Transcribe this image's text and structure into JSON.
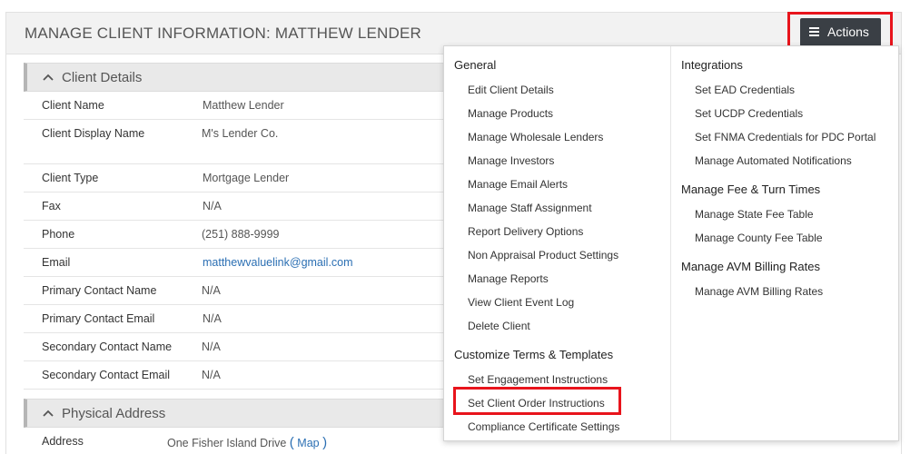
{
  "header": {
    "title": "MANAGE CLIENT INFORMATION: MATTHEW LENDER"
  },
  "actions": {
    "label": "Actions",
    "icon": "menu-icon"
  },
  "client_details": {
    "title": "Client Details",
    "rows": [
      {
        "label": "Client Name",
        "value": "Matthew Lender"
      },
      {
        "label": "Client Display Name",
        "value": "M's Lender Co."
      },
      {
        "label": "Client Type",
        "value": "Mortgage Lender"
      },
      {
        "label": "Fax",
        "value": "N/A"
      },
      {
        "label": "Phone",
        "value": "(251) 888-9999"
      },
      {
        "label": "Email",
        "value": "matthewvaluelink@gmail.com"
      },
      {
        "label": "Primary Contact Name",
        "value": "N/A"
      },
      {
        "label": "Primary Contact Email",
        "value": "N/A"
      },
      {
        "label": "Secondary Contact Name",
        "value": "N/A"
      },
      {
        "label": "Secondary Contact Email",
        "value": "N/A"
      }
    ]
  },
  "physical_address": {
    "title": "Physical Address",
    "address_label": "Address",
    "address_value": "One Fisher Island Drive",
    "open_paren": "(",
    "map_link": "Map",
    "close_paren": ")"
  },
  "menu": {
    "left": [
      {
        "group": "General",
        "items": [
          "Edit Client Details",
          "Manage Products",
          "Manage Wholesale Lenders",
          "Manage Investors",
          "Manage Email Alerts",
          "Manage Staff Assignment",
          "Report Delivery Options",
          "Non Appraisal Product Settings",
          "Manage Reports",
          "View Client Event Log",
          "Delete Client"
        ]
      },
      {
        "group": "Customize Terms & Templates",
        "items": [
          "Set Engagement Instructions",
          "Set Client Order Instructions",
          "Compliance Certificate Settings"
        ]
      }
    ],
    "right": [
      {
        "group": "Integrations",
        "items": [
          "Set EAD Credentials",
          "Set UCDP Credentials",
          "Set FNMA Credentials for PDC Portal",
          "Manage Automated Notifications"
        ]
      },
      {
        "group": "Manage Fee & Turn Times",
        "items": [
          "Manage State Fee Table",
          "Manage County Fee Table"
        ]
      },
      {
        "group": "Manage AVM Billing Rates",
        "items": [
          "Manage AVM Billing Rates"
        ]
      }
    ]
  },
  "colors": {
    "highlight": "#e8141c",
    "link": "#2b6fb3",
    "button": "#3a3f45"
  }
}
